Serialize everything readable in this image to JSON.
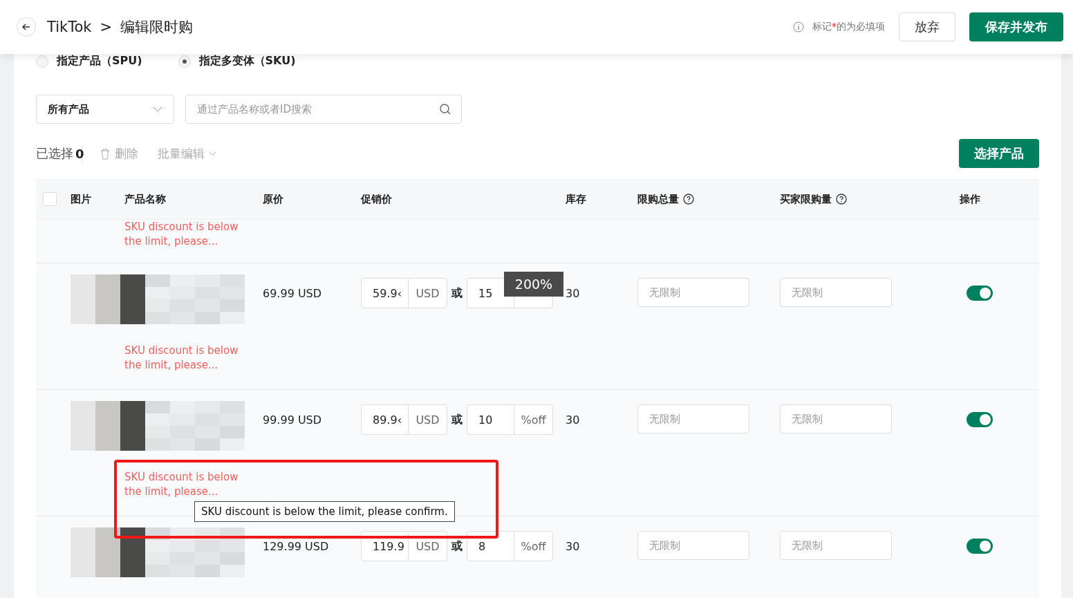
{
  "header": {
    "brand": "TikTok",
    "separator": ">",
    "title": "编辑限时购",
    "required_note_prefix": "标记",
    "required_mark": "*",
    "required_note_suffix": "的为必填项",
    "discard": "放弃",
    "save": "保存并发布"
  },
  "scope_options": [
    {
      "label": "指定产品（SPU)",
      "selected": false
    },
    {
      "label": "指定多变体（SKU)",
      "selected": true
    }
  ],
  "filter": {
    "value": "所有产品",
    "search_placeholder": "通过产品名称或者ID搜索"
  },
  "toolbar": {
    "selected_label": "已选择",
    "selected_count": "0",
    "delete": "删除",
    "bulk_edit": "批量编辑",
    "choose_products": "选择产品"
  },
  "table": {
    "select_all_checked": false,
    "columns": [
      "图片",
      "产品名称",
      "原价",
      "促销价",
      "库存",
      "限购总量",
      "买家限购量",
      "操作"
    ],
    "partial_row_error": "SKU discount is below the limit, please...",
    "rows": [
      {
        "price": "69.99 USD",
        "sale_price": "59.9‹",
        "currency": "USD",
        "or": "或",
        "discount": "15",
        "stock": "30",
        "total_limit_placeholder": "无限制",
        "buyer_limit_placeholder": "无限制",
        "on": true,
        "error": "SKU discount is below the limit, please..."
      },
      {
        "price": "99.99 USD",
        "sale_price": "89.9‹",
        "currency": "USD",
        "or": "或",
        "discount": "10",
        "suffix": "%off",
        "stock": "30",
        "total_limit_placeholder": "无限制",
        "buyer_limit_placeholder": "无限制",
        "on": true,
        "error": "SKU discount is below the limit, please..."
      },
      {
        "price": "129.99 USD",
        "sale_price": "119.9",
        "currency": "USD",
        "or": "或",
        "discount": "8",
        "suffix": "%off",
        "stock": "30",
        "total_limit_placeholder": "无限制",
        "buyer_limit_placeholder": "无限制",
        "on": true
      }
    ]
  },
  "zoom_badge": "200%",
  "tooltip": "SKU discount is below the limit, please confirm."
}
